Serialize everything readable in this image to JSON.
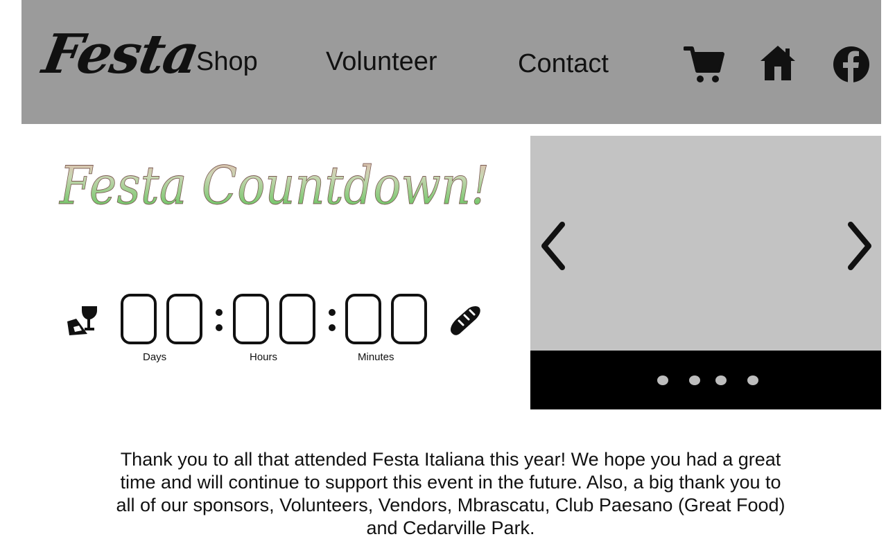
{
  "header": {
    "logo": "Festa",
    "nav": [
      {
        "label": "Shop"
      },
      {
        "label": "Volunteer"
      },
      {
        "label": "Contact"
      }
    ],
    "icons": [
      "cart-icon",
      "home-icon",
      "facebook-icon"
    ]
  },
  "countdown": {
    "title": "Festa Countdown!",
    "labels": {
      "days": "Days",
      "hours": "Hours",
      "minutes": "Minutes"
    },
    "icons": [
      "wine-glass-icon",
      "bread-icon"
    ]
  },
  "carousel": {
    "prev_icon": "chevron-left-icon",
    "next_icon": "chevron-right-icon",
    "slides_count": 4
  },
  "message": {
    "text": "Thank you to all that attended Festa Italiana this year!  We hope you had a great\ntime and will continue to support this event in the future.  Also, a big thank you to\nall of our sponsors, Volunteers, Vendors, Mbrascatu, Club Paesano (Great Food)\nand Cedarville Park."
  },
  "colors": {
    "header_bg": "#9b9b9b",
    "carousel_bg": "#c3c3c3",
    "carousel_footer": "#000000",
    "title_gradient_top": "#d9a8a0",
    "title_gradient_bottom": "#5fc35a"
  }
}
